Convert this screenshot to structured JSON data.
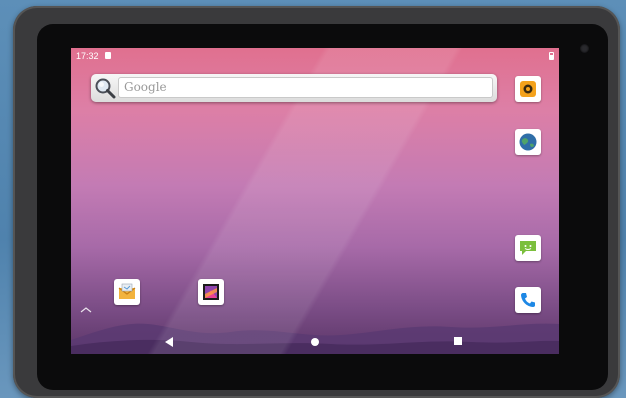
{
  "status_bar": {
    "time": "17:32",
    "notification_icon": "notification-icon",
    "battery_icon": "battery-icon"
  },
  "search_widget": {
    "placeholder": "Google",
    "icon": "search-icon"
  },
  "home_icons": {
    "right_column": [
      "camera-app-icon",
      "browser-app-icon",
      "messaging-app-icon",
      "phone-app-icon"
    ],
    "bottom_row": [
      "email-app-icon",
      "gallery-app-icon"
    ]
  },
  "nav_bar": {
    "buttons": [
      "back-button",
      "home-button",
      "recents-button"
    ]
  },
  "colors": {
    "wallpaper_top": "#e0708f",
    "wallpaper_bottom": "#5b3668",
    "device_frame": "#3a3a3c",
    "background": "#5d8fb8"
  }
}
